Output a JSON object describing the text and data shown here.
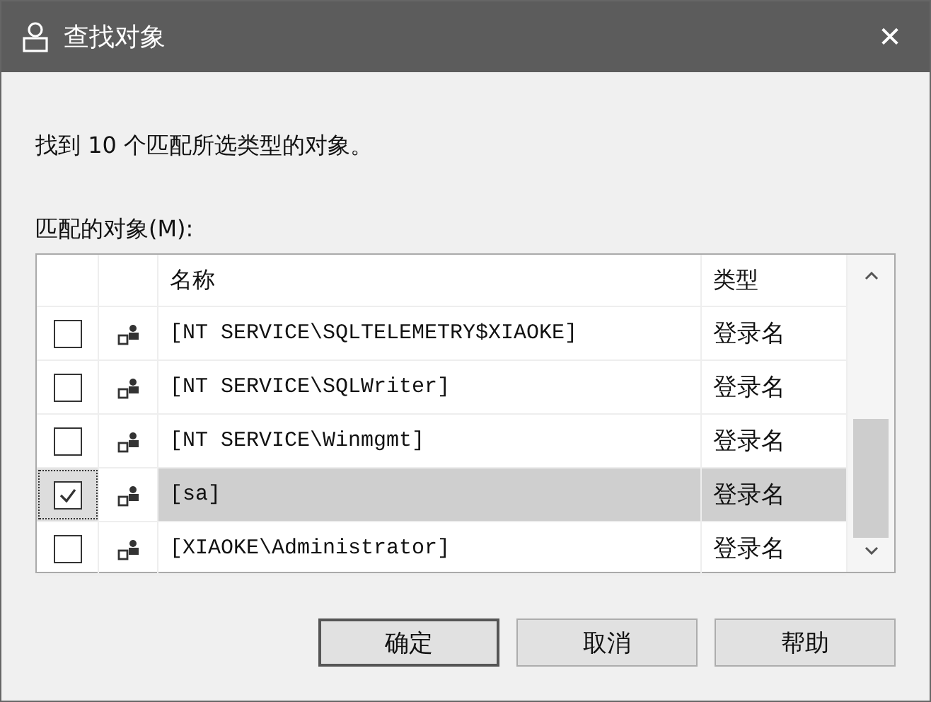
{
  "window": {
    "title": "查找对象",
    "close": "✕"
  },
  "message": "找到 10 个匹配所选类型的对象。",
  "list_label": "匹配的对象(M):",
  "table": {
    "columns": [
      "名称",
      "类型"
    ],
    "rows": [
      {
        "checked": false,
        "selected": false,
        "name": "[NT SERVICE\\SQLTELEMETRY$XIAOKE]",
        "type": "登录名"
      },
      {
        "checked": false,
        "selected": false,
        "name": "[NT SERVICE\\SQLWriter]",
        "type": "登录名"
      },
      {
        "checked": false,
        "selected": false,
        "name": "[NT SERVICE\\Winmgmt]",
        "type": "登录名"
      },
      {
        "checked": true,
        "selected": true,
        "name": "[sa]",
        "type": "登录名"
      },
      {
        "checked": false,
        "selected": false,
        "name": "[XIAOKE\\Administrator]",
        "type": "登录名"
      }
    ]
  },
  "buttons": [
    {
      "label": "确定",
      "default": true
    },
    {
      "label": "取消",
      "default": false
    },
    {
      "label": "帮助",
      "default": false
    }
  ]
}
